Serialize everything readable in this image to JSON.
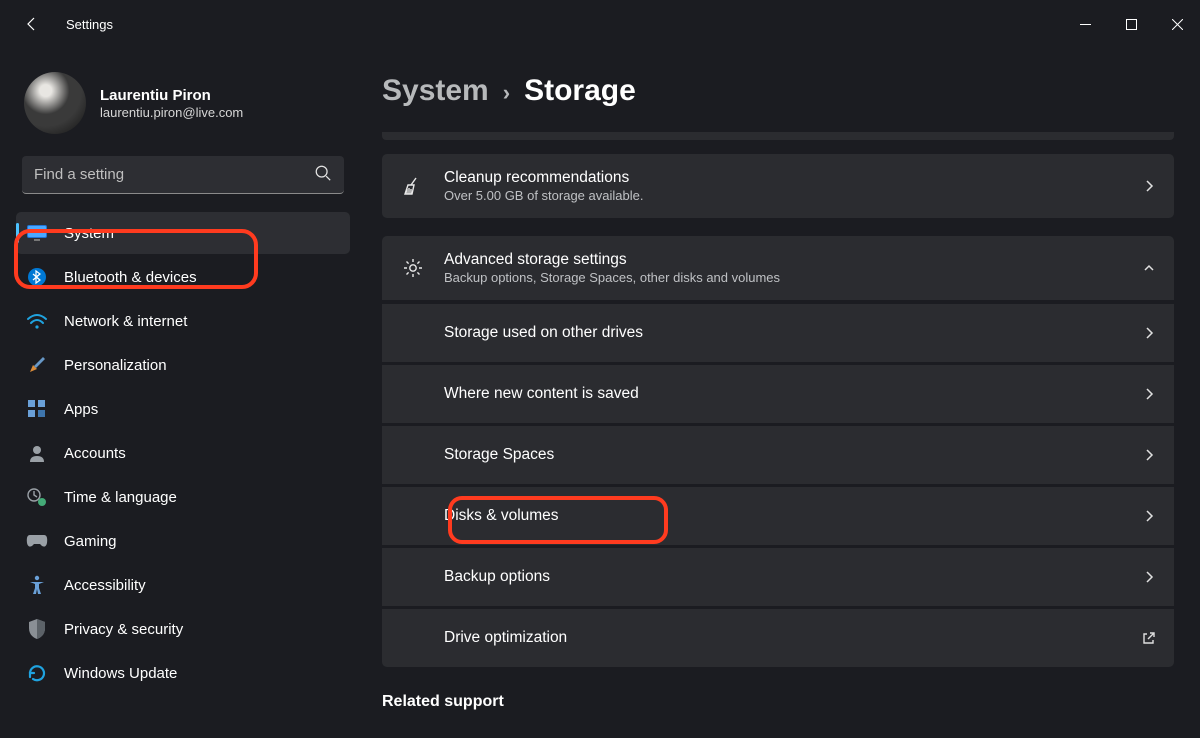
{
  "app_title": "Settings",
  "profile": {
    "name": "Laurentiu Piron",
    "email": "laurentiu.piron@live.com"
  },
  "search": {
    "placeholder": "Find a setting"
  },
  "nav": {
    "items": [
      {
        "label": "System",
        "selected": true
      },
      {
        "label": "Bluetooth & devices"
      },
      {
        "label": "Network & internet"
      },
      {
        "label": "Personalization"
      },
      {
        "label": "Apps"
      },
      {
        "label": "Accounts"
      },
      {
        "label": "Time & language"
      },
      {
        "label": "Gaming"
      },
      {
        "label": "Accessibility"
      },
      {
        "label": "Privacy & security"
      },
      {
        "label": "Windows Update"
      }
    ]
  },
  "breadcrumb": {
    "parent": "System",
    "current": "Storage"
  },
  "cards": {
    "cleanup": {
      "title": "Cleanup recommendations",
      "subtitle": "Over 5.00 GB of storage available."
    },
    "advanced": {
      "title": "Advanced storage settings",
      "subtitle": "Backup options, Storage Spaces, other disks and volumes"
    },
    "sub": [
      "Storage used on other drives",
      "Where new content is saved",
      "Storage Spaces",
      "Disks & volumes",
      "Backup options",
      "Drive optimization"
    ]
  },
  "related_heading": "Related support"
}
